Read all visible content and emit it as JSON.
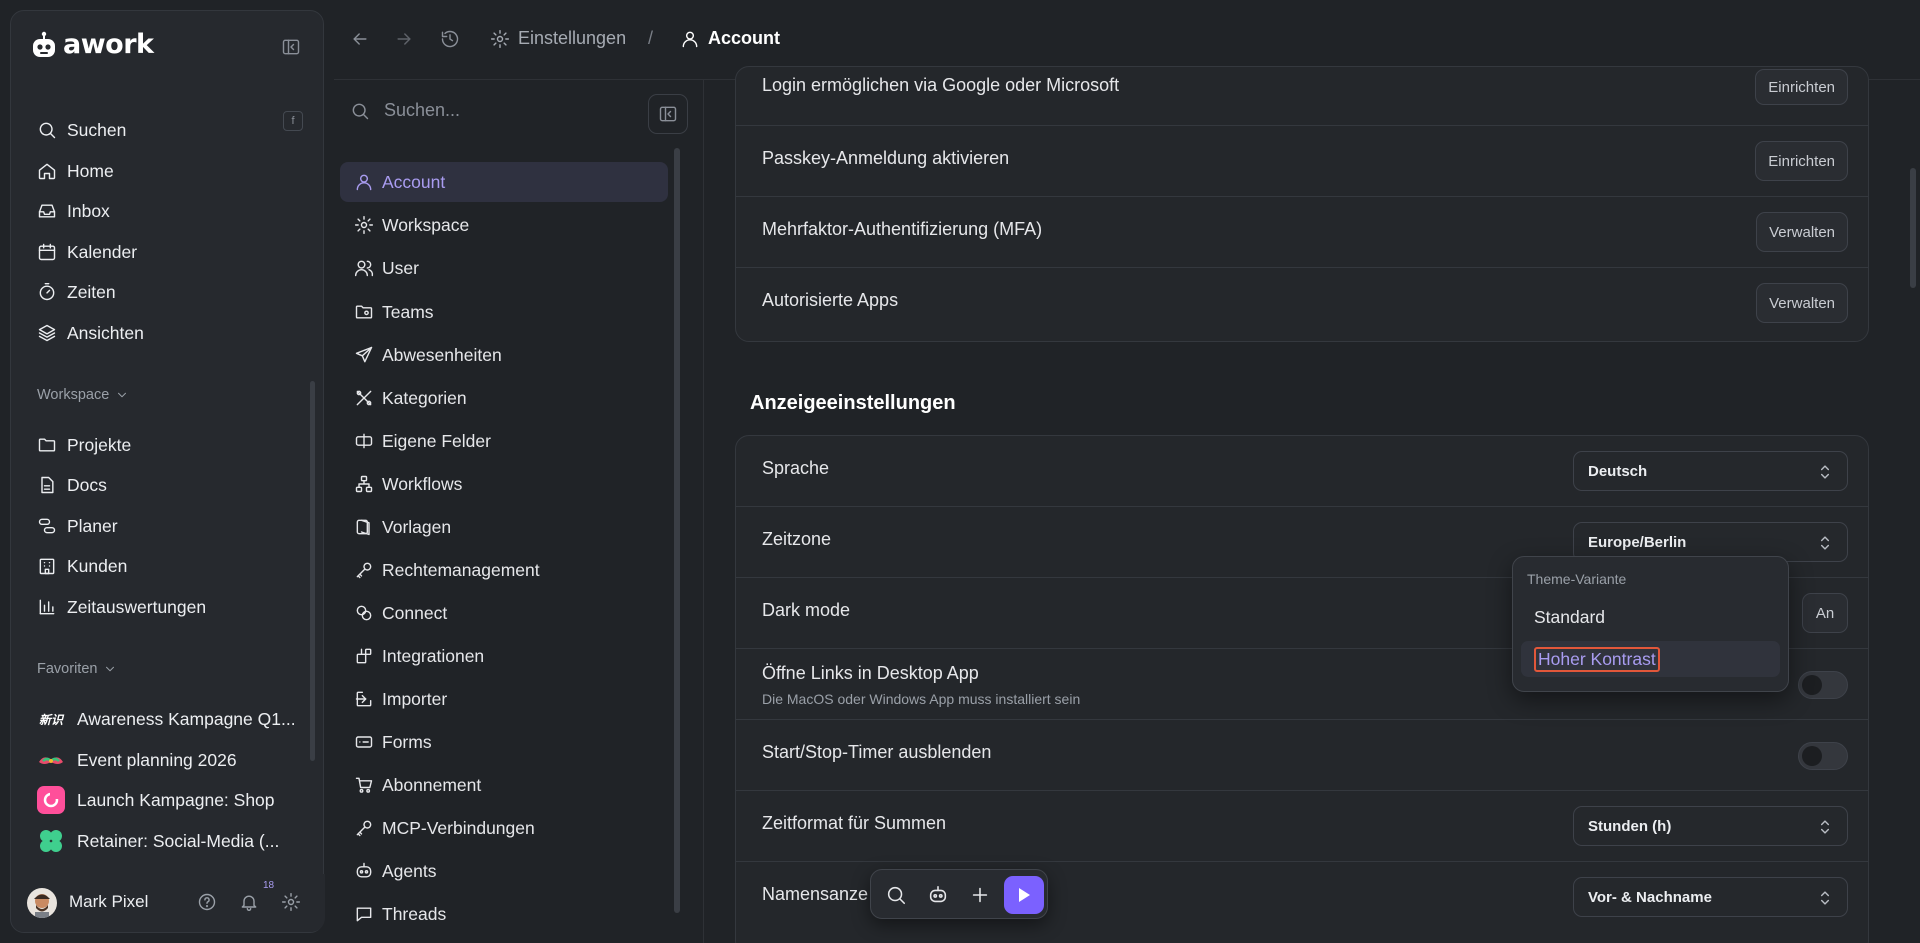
{
  "app": {
    "name": "awork"
  },
  "nav": {
    "search_label": "Suchen",
    "search_shortcut": "f",
    "items": [
      "Home",
      "Inbox",
      "Kalender",
      "Zeiten",
      "Ansichten"
    ],
    "workspace_title": "Workspace",
    "workspace_items": [
      "Projekte",
      "Docs",
      "Planer",
      "Kunden",
      "Zeitauswertungen"
    ],
    "favorites_title": "Favoriten",
    "favorites": [
      "Awareness Kampagne Q1...",
      "Event planning 2026",
      "Launch Kampagne: Shop",
      "Retainer: Social-Media (..."
    ],
    "user_name": "Mark Pixel",
    "notif_count": "18"
  },
  "topbar": {
    "crumb_settings": "Einstellungen",
    "crumb_sep": "/",
    "crumb_account": "Account"
  },
  "submenu": {
    "search_placeholder": "Suchen...",
    "items": [
      "Account",
      "Workspace",
      "User",
      "Teams",
      "Abwesenheiten",
      "Kategorien",
      "Eigene Felder",
      "Workflows",
      "Vorlagen",
      "Rechtemanagement",
      "Connect",
      "Integrationen",
      "Importer",
      "Forms",
      "Abonnement",
      "MCP-Verbindungen",
      "Agents",
      "Threads"
    ]
  },
  "security": {
    "rows": [
      {
        "label": "Login ermöglichen via Google oder Microsoft",
        "action": "Einrichten"
      },
      {
        "label": "Passkey-Anmeldung aktivieren",
        "action": "Einrichten"
      },
      {
        "label": "Mehrfaktor-Authentifizierung (MFA)",
        "action": "Verwalten"
      },
      {
        "label": "Autorisierte Apps",
        "action": "Verwalten"
      }
    ]
  },
  "display": {
    "title": "Anzeigeeinstellungen",
    "language_label": "Sprache",
    "language_value": "Deutsch",
    "timezone_label": "Zeitzone",
    "timezone_value": "Europe/Berlin",
    "darkmode_label": "Dark mode",
    "darkmode_value": "An",
    "links_label": "Öffne Links in Desktop App",
    "links_sub": "Die MacOS oder Windows App muss installiert sein",
    "timer_label": "Start/Stop-Timer ausblenden",
    "timeformat_label": "Zeitformat für Summen",
    "timeformat_value": "Stunden (h)",
    "names_label": "Namensanze",
    "names_value": "Vor- & Nachname"
  },
  "theme_popover": {
    "title": "Theme-Variante",
    "options": [
      "Standard",
      "Hoher Kontrast"
    ]
  },
  "colors": {
    "accent": "#7b61ff",
    "accent_text": "#a99cf0",
    "background": "#202327"
  }
}
